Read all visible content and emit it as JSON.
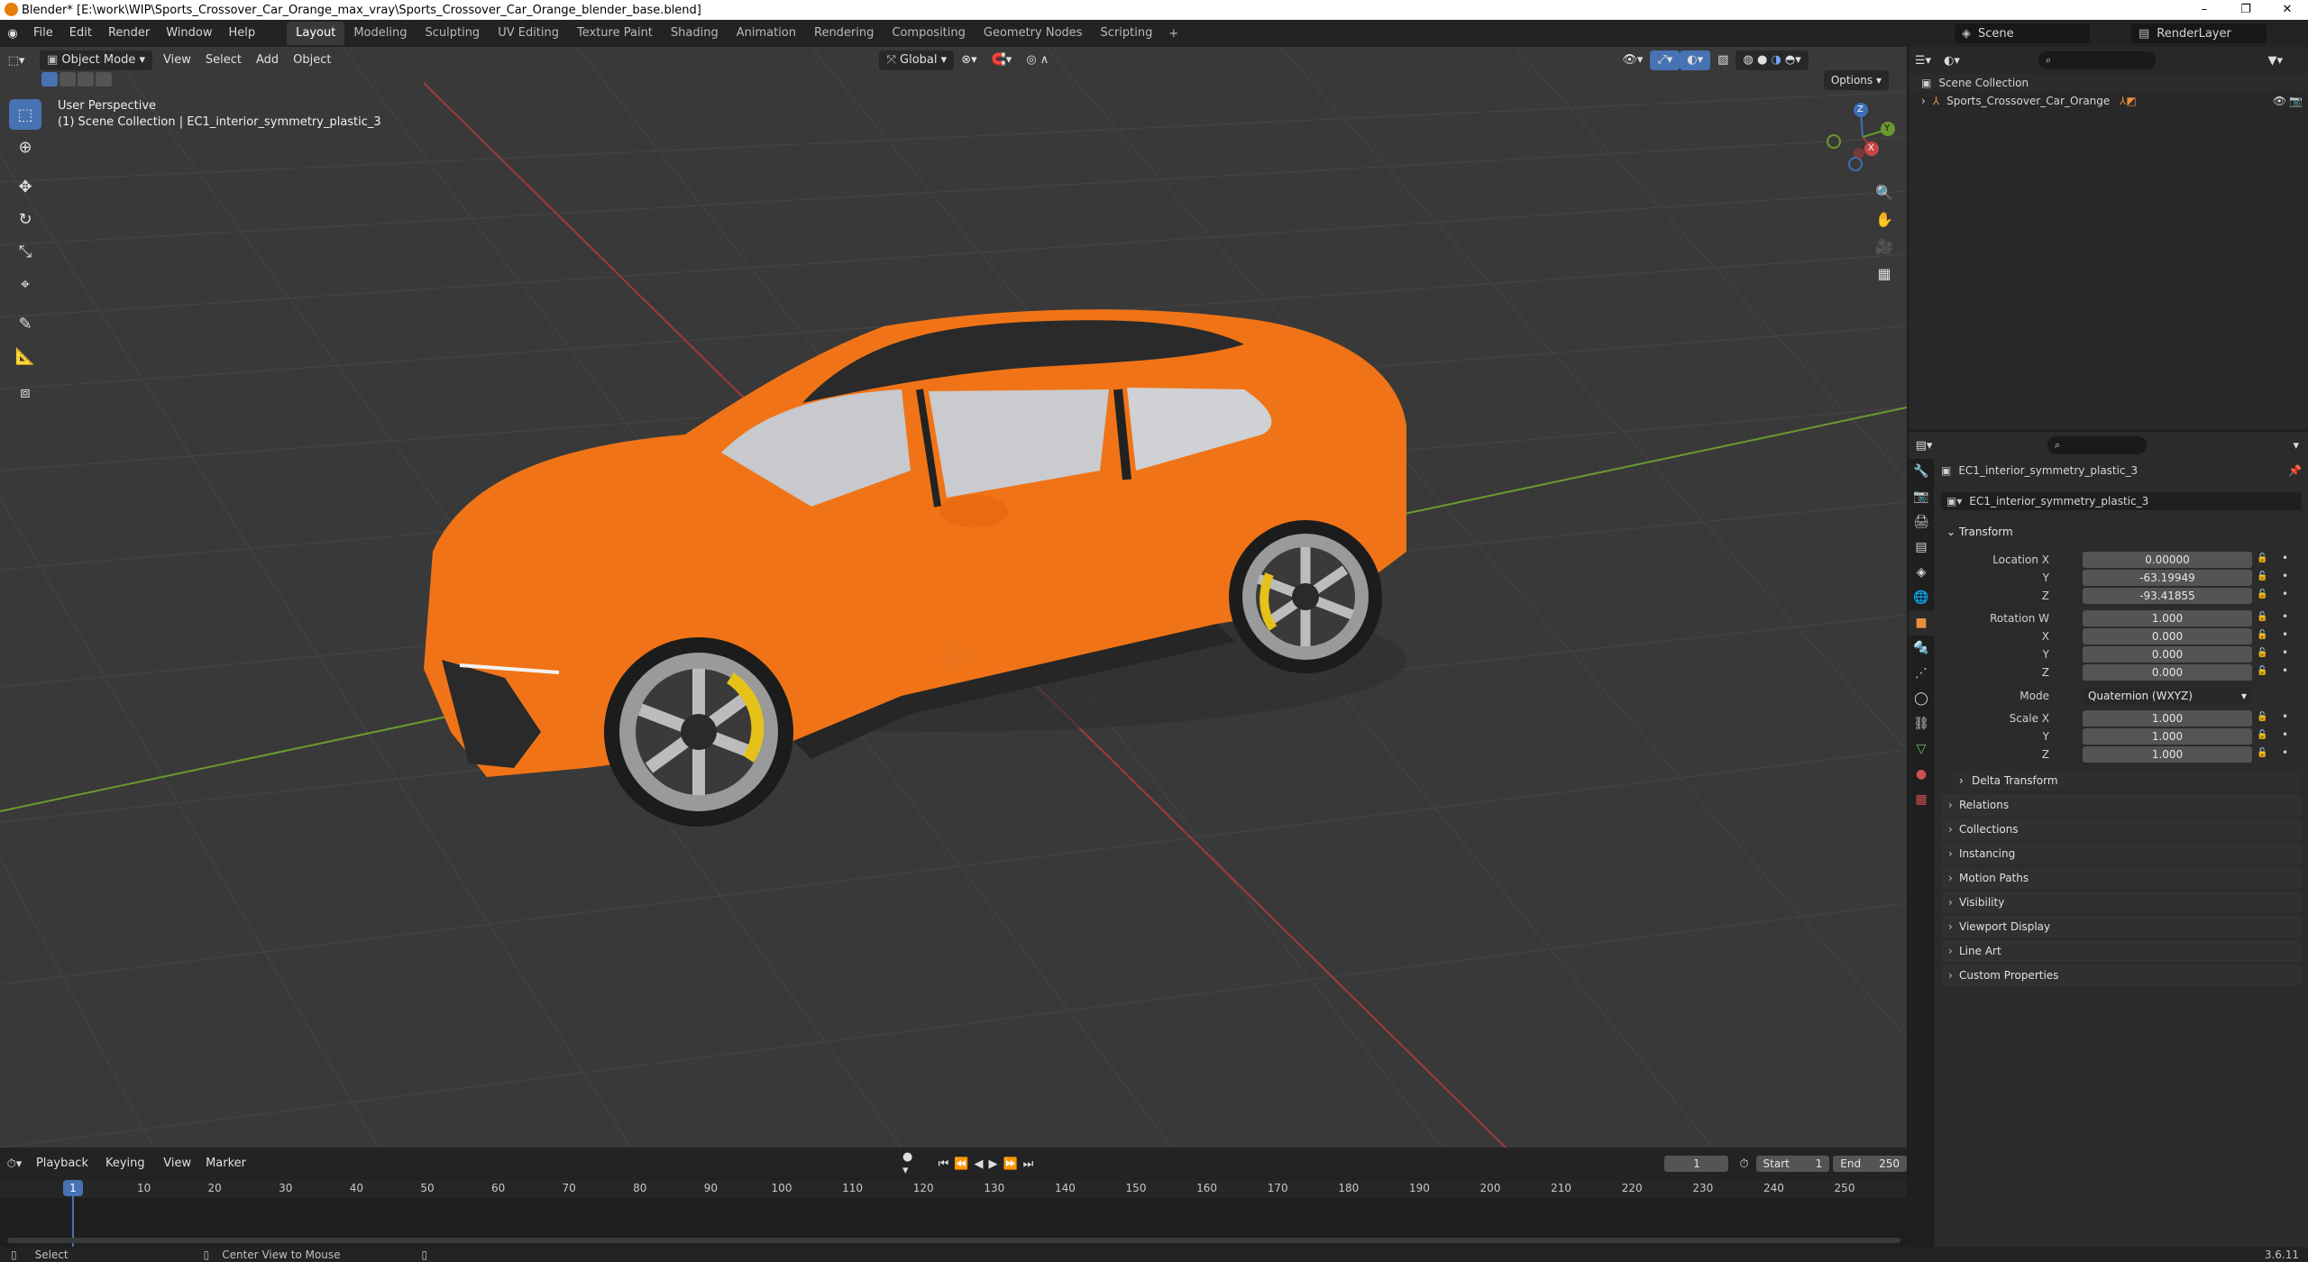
{
  "titlebar": {
    "text": "Blender* [E:\\work\\WIP\\Sports_Crossover_Car_Orange_max_vray\\Sports_Crossover_Car_Orange_blender_base.blend]",
    "minimize": "–",
    "restore": "❐",
    "close": "✕"
  },
  "menu": [
    "File",
    "Edit",
    "Render",
    "Window",
    "Help"
  ],
  "workspaces": [
    "Layout",
    "Modeling",
    "Sculpting",
    "UV Editing",
    "Texture Paint",
    "Shading",
    "Animation",
    "Rendering",
    "Compositing",
    "Geometry Nodes",
    "Scripting"
  ],
  "scene": {
    "name": "Scene",
    "view_layer": "RenderLayer"
  },
  "viewport": {
    "mode": "Object Mode",
    "menus": [
      "View",
      "Select",
      "Add",
      "Object"
    ],
    "orientation": "Global",
    "options_label": "Options",
    "perspective": "User Perspective",
    "collection_info": "(1) Scene Collection | EC1_interior_symmetry_plastic_3",
    "gizmo_labels": {
      "z": "Z",
      "y": "Y",
      "x": "X"
    },
    "colors": {
      "body": "#f07417",
      "bg": "#393939",
      "grid": "#454545",
      "x_axis": "#a33a3a",
      "y_axis": "#6a9a2e"
    }
  },
  "outliner": {
    "root": "Scene Collection",
    "item": "Sports_Crossover_Car_Orange"
  },
  "properties": {
    "object_name": "EC1_interior_symmetry_plastic_3",
    "data_name": "EC1_interior_symmetry_plastic_3",
    "transform_header": "Transform",
    "location_label": "Location X",
    "location": {
      "x": "0.00000",
      "y": "-63.19949",
      "z": "-93.41855"
    },
    "rotation_label": "Rotation W",
    "rotation": {
      "w": "1.000",
      "x": "0.000",
      "y": "0.000",
      "z": "0.000"
    },
    "mode_label": "Mode",
    "mode": "Quaternion (WXYZ)",
    "scale_label": "Scale X",
    "scale": {
      "x": "1.000",
      "y": "1.000",
      "z": "1.000"
    },
    "axis_y": "Y",
    "axis_z": "Z",
    "axis_x": "X",
    "delta_transform": "Delta Transform",
    "panels": [
      "Relations",
      "Collections",
      "Instancing",
      "Motion Paths",
      "Visibility",
      "Viewport Display",
      "Line Art",
      "Custom Properties"
    ]
  },
  "timeline": {
    "menus": [
      "Playback",
      "Keying",
      "View",
      "Marker"
    ],
    "current_frame": "1",
    "start_label": "Start",
    "start": "1",
    "end_label": "End",
    "end": "250",
    "ticks": [
      "10",
      "20",
      "30",
      "40",
      "50",
      "60",
      "70",
      "80",
      "90",
      "100",
      "110",
      "120",
      "130",
      "140",
      "150",
      "160",
      "170",
      "180",
      "190",
      "200",
      "210",
      "220",
      "230",
      "240",
      "250"
    ]
  },
  "statusbar": {
    "select": "Select",
    "center": "Center View to Mouse",
    "version": "3.6.11"
  }
}
